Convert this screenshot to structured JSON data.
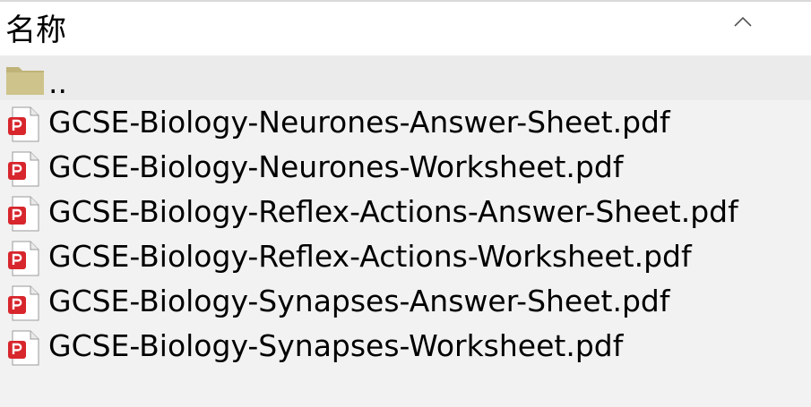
{
  "header": {
    "column_label": "名称",
    "sort_icon": "chevron-up-icon"
  },
  "list": {
    "parent": {
      "label": "..",
      "icon": "folder-icon",
      "icon_color": "#c8bd84"
    },
    "files": [
      {
        "name": "GCSE-Biology-Neurones-Answer-Sheet.pdf",
        "icon": "pdf-file-icon"
      },
      {
        "name": "GCSE-Biology-Neurones-Worksheet.pdf",
        "icon": "pdf-file-icon"
      },
      {
        "name": "GCSE-Biology-Reflex-Actions-Answer-Sheet.pdf",
        "icon": "pdf-file-icon"
      },
      {
        "name": "GCSE-Biology-Reflex-Actions-Worksheet.pdf",
        "icon": "pdf-file-icon"
      },
      {
        "name": "GCSE-Biology-Synapses-Answer-Sheet.pdf",
        "icon": "pdf-file-icon"
      },
      {
        "name": "GCSE-Biology-Synapses-Worksheet.pdf",
        "icon": "pdf-file-icon"
      }
    ],
    "pdf_accent": "#d7262c"
  }
}
